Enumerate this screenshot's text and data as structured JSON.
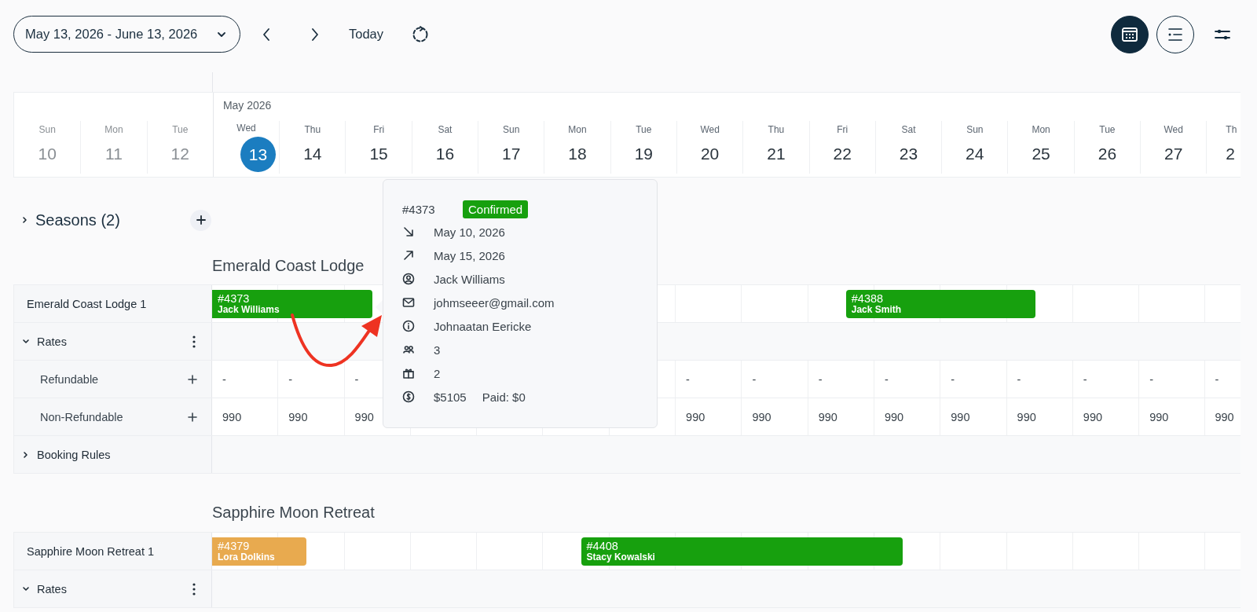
{
  "toolbar": {
    "date_range": "May 13, 2026 - June 13, 2026",
    "today": "Today",
    "view_buttons": [
      {
        "kind": "calendar",
        "selected": true
      },
      {
        "kind": "list",
        "selected": false
      }
    ]
  },
  "calendar": {
    "month": "May 2026",
    "days": [
      {
        "weekday": "Sun",
        "date": "10",
        "past": true,
        "today": false
      },
      {
        "weekday": "Mon",
        "date": "11",
        "past": true,
        "today": false
      },
      {
        "weekday": "Tue",
        "date": "12",
        "past": true,
        "today": false
      },
      {
        "weekday": "Wed",
        "date": "13",
        "past": false,
        "today": true
      },
      {
        "weekday": "Thu",
        "date": "14",
        "past": false,
        "today": false
      },
      {
        "weekday": "Fri",
        "date": "15",
        "past": false,
        "today": false
      },
      {
        "weekday": "Sat",
        "date": "16",
        "past": false,
        "today": false
      },
      {
        "weekday": "Sun",
        "date": "17",
        "past": false,
        "today": false
      },
      {
        "weekday": "Mon",
        "date": "18",
        "past": false,
        "today": false
      },
      {
        "weekday": "Tue",
        "date": "19",
        "past": false,
        "today": false
      },
      {
        "weekday": "Wed",
        "date": "20",
        "past": false,
        "today": false
      },
      {
        "weekday": "Thu",
        "date": "21",
        "past": false,
        "today": false
      },
      {
        "weekday": "Fri",
        "date": "22",
        "past": false,
        "today": false
      },
      {
        "weekday": "Sat",
        "date": "23",
        "past": false,
        "today": false
      },
      {
        "weekday": "Sun",
        "date": "24",
        "past": false,
        "today": false
      },
      {
        "weekday": "Mon",
        "date": "25",
        "past": false,
        "today": false
      },
      {
        "weekday": "Tue",
        "date": "26",
        "past": false,
        "today": false
      },
      {
        "weekday": "Wed",
        "date": "27",
        "past": false,
        "today": false
      },
      {
        "weekday": "Th",
        "date": "2",
        "past": false,
        "today": false
      }
    ]
  },
  "seasons": {
    "label": "Seasons (2)",
    "expanded": false
  },
  "properties": [
    {
      "name": "Emerald Coast Lodge",
      "rows": [
        {
          "kind": "room",
          "label": "Emerald Coast Lodge 1",
          "bookings": [
            {
              "number": "#4373",
              "guest": "Jack Williams",
              "color": "#17a00e",
              "continues": true
            },
            {
              "number": "#4388",
              "guest": "Jack Smith",
              "color": "#17a00e",
              "continues": false
            }
          ]
        },
        {
          "kind": "group",
          "label": "Rates",
          "expanded": true,
          "menu": true
        },
        {
          "kind": "rate",
          "label": "Refundable",
          "values_before": [
            "-",
            "-",
            "-"
          ],
          "values_after": [
            "-",
            "-",
            "-",
            "-",
            "-",
            "-",
            "-",
            "-",
            "-"
          ]
        },
        {
          "kind": "rate",
          "label": "Non-Refundable",
          "values_before": [
            "990",
            "990",
            "990"
          ],
          "values_after": [
            "990",
            "990",
            "990",
            "990",
            "990",
            "990",
            "990",
            "990",
            "990"
          ]
        },
        {
          "kind": "group",
          "label": "Booking Rules",
          "expanded": false,
          "menu": false
        }
      ]
    },
    {
      "name": "Sapphire Moon Retreat",
      "rows": [
        {
          "kind": "room",
          "label": "Sapphire Moon Retreat 1",
          "bookings": [
            {
              "number": "#4379",
              "guest": "Lora Dolkins",
              "color": "#e8aa4f",
              "continues": true
            },
            {
              "number": "#4408",
              "guest": "Stacy Kowalski",
              "color": "#17a00e",
              "continues": false
            }
          ]
        },
        {
          "kind": "group",
          "label": "Rates",
          "expanded": true,
          "menu": true
        }
      ]
    }
  ],
  "popup": {
    "number": "#4373",
    "status": "Confirmed",
    "details": [
      {
        "kind": "check-in",
        "text": "May 10, 2026"
      },
      {
        "kind": "check-out",
        "text": "May 15, 2026"
      },
      {
        "kind": "guest",
        "text": "Jack Williams"
      },
      {
        "kind": "email",
        "text": "johmseeer@gmail.com"
      },
      {
        "kind": "note",
        "text": "Johnaatan Eericke"
      },
      {
        "kind": "people",
        "text": "3"
      },
      {
        "kind": "extras",
        "text": "2"
      },
      {
        "kind": "price",
        "text": "$5105",
        "paid": "Paid: $0"
      }
    ]
  }
}
